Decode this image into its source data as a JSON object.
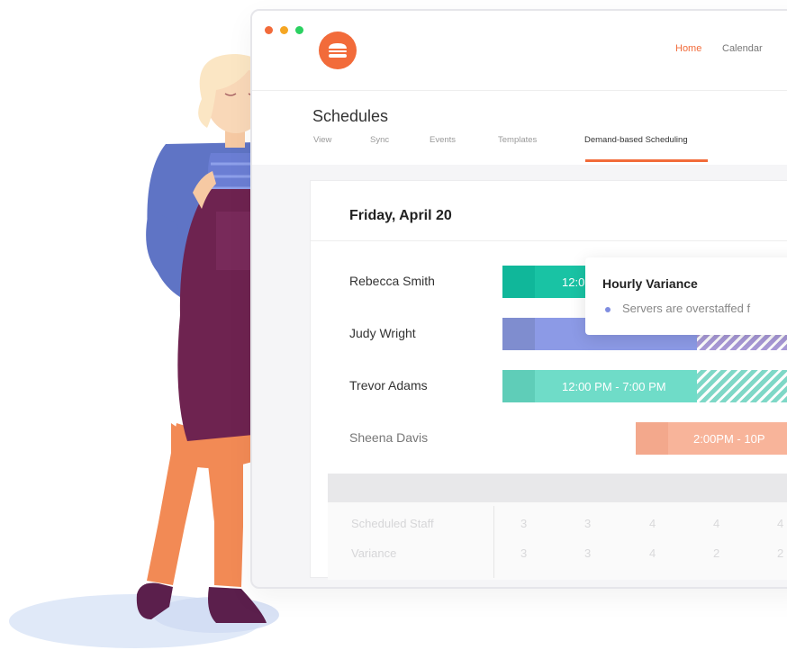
{
  "window": {
    "traffic_lights": {
      "close": "#f26b3a",
      "minimize": "#f5a623",
      "zoom": "#2bd161"
    },
    "logo_icon": "burger-icon",
    "nav": [
      {
        "label": "Home",
        "active": true
      },
      {
        "label": "Calendar",
        "active": false
      }
    ]
  },
  "page": {
    "title": "Schedules",
    "tabs": [
      {
        "label": "View",
        "active": false
      },
      {
        "label": "Sync",
        "active": false
      },
      {
        "label": "Events",
        "active": false
      },
      {
        "label": "Templates",
        "active": false
      },
      {
        "label": "Demand-based Scheduling",
        "active": true
      }
    ]
  },
  "schedule": {
    "date": "Friday, April 20",
    "employees": [
      {
        "name": "Rebecca Smith",
        "shift": "12:0",
        "color": "#19c3a4"
      },
      {
        "name": "Judy Wright",
        "shift": "",
        "color": "#8c9ae6"
      },
      {
        "name": "Trevor Adams",
        "shift": "12:00 PM - 7:00 PM",
        "color": "#6fdcc8"
      },
      {
        "name": "Sheena Davis",
        "shift": "2:00PM - 10P",
        "color": "#f8b49a"
      }
    ]
  },
  "tooltip": {
    "title": "Hourly Variance",
    "text": "Servers are overstaffed f"
  },
  "summary": {
    "rows": [
      {
        "label": "Scheduled Staff",
        "values": [
          "3",
          "3",
          "4",
          "4",
          "4"
        ]
      },
      {
        "label": "Variance",
        "values": [
          "3",
          "3",
          "4",
          "2",
          "2"
        ]
      }
    ]
  },
  "colors": {
    "accent": "#f26b3a",
    "teal": "#19c3a4",
    "purple": "#8c9ae6",
    "salmon": "#f8b49a"
  }
}
